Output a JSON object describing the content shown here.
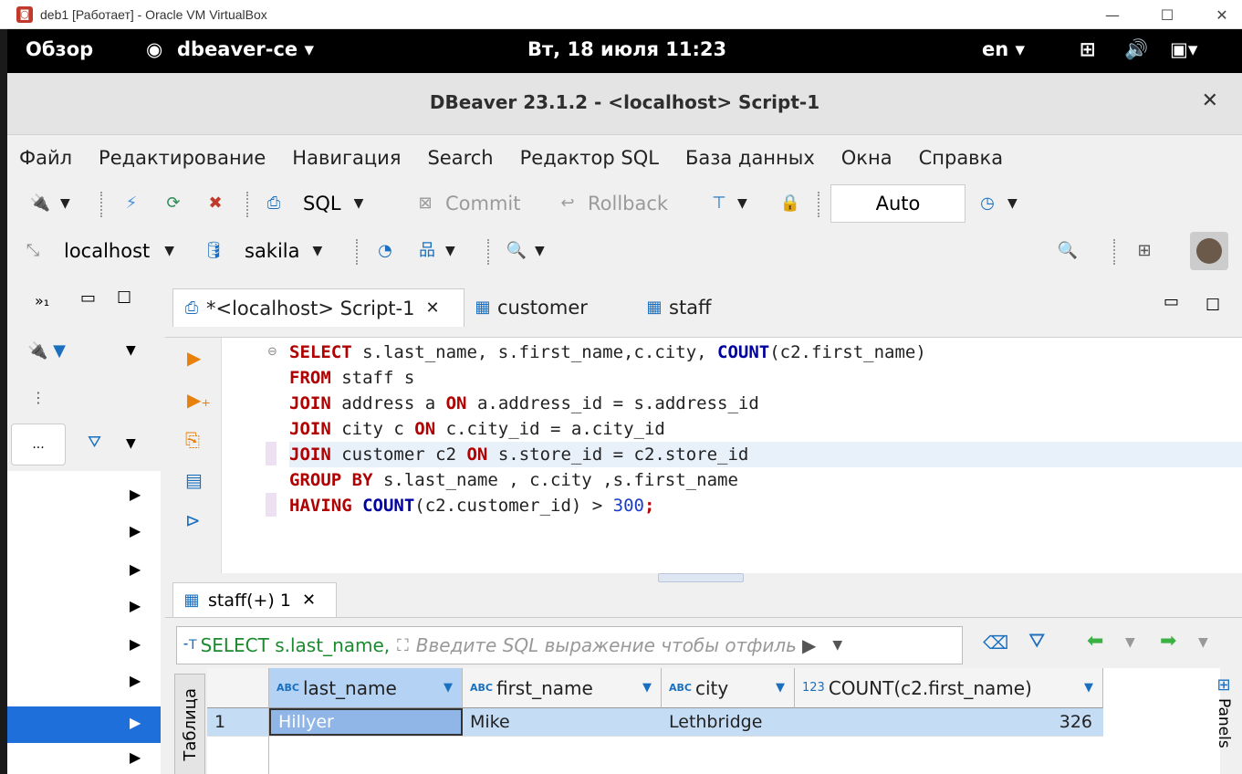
{
  "vbox": {
    "title": "deb1 [Работает] - Oracle VM VirtualBox"
  },
  "gnome": {
    "overview": "Обзор",
    "app": "dbeaver-ce",
    "datetime": "Вт, 18 июля  11:23",
    "lang": "en"
  },
  "window": {
    "title": "DBeaver 23.1.2 - <localhost> Script-1"
  },
  "menu": [
    "Файл",
    "Редактирование",
    "Навигация",
    "Search",
    "Редактор SQL",
    "База данных",
    "Окна",
    "Справка"
  ],
  "toolbar1": {
    "sql": "SQL",
    "commit": "Commit",
    "rollback": "Rollback",
    "mode": "Auto"
  },
  "toolbar2": {
    "datasource": "localhost",
    "schema": "sakila"
  },
  "leftpane": {
    "search_placeholder": "..."
  },
  "tabs": [
    {
      "label": "*<localhost> Script-1"
    },
    {
      "label": "customer"
    },
    {
      "label": "staff"
    }
  ],
  "code_lines": [
    [
      {
        "t": "SELECT",
        "c": "kw"
      },
      {
        "t": " s.last_name, s.first_name,c.city, ",
        "c": ""
      },
      {
        "t": "COUNT",
        "c": "fn"
      },
      {
        "t": "(c2.first_name)",
        "c": ""
      }
    ],
    [
      {
        "t": "FROM",
        "c": "kw"
      },
      {
        "t": " staff s",
        "c": ""
      }
    ],
    [
      {
        "t": "JOIN",
        "c": "kw"
      },
      {
        "t": " address a ",
        "c": ""
      },
      {
        "t": "ON",
        "c": "kw"
      },
      {
        "t": " a.address_id = s.address_id",
        "c": ""
      }
    ],
    [
      {
        "t": "JOIN",
        "c": "kw"
      },
      {
        "t": " city c ",
        "c": ""
      },
      {
        "t": "ON",
        "c": "kw"
      },
      {
        "t": " c.city_id = a.city_id",
        "c": ""
      }
    ],
    [
      {
        "t": "JOIN",
        "c": "kw"
      },
      {
        "t": " customer c2 ",
        "c": ""
      },
      {
        "t": "ON",
        "c": "kw"
      },
      {
        "t": " s.store_id = c2.store_id",
        "c": ""
      }
    ],
    [
      {
        "t": "GROUP BY",
        "c": "kw"
      },
      {
        "t": " s.last_name , c.city ,s.first_name",
        "c": ""
      }
    ],
    [
      {
        "t": "HAVING",
        "c": "kw"
      },
      {
        "t": " ",
        "c": ""
      },
      {
        "t": "COUNT",
        "c": "fn"
      },
      {
        "t": "(c2.customer_id) > ",
        "c": ""
      },
      {
        "t": "300",
        "c": "num"
      },
      {
        "t": ";",
        "c": "kw"
      }
    ]
  ],
  "results": {
    "tab_label": "staff(+) 1",
    "query_preview": "SELECT s.last_name,",
    "filter_placeholder": "Введите SQL выражение чтобы отфиль",
    "side_label": "Таблица",
    "panels_label": "Panels",
    "columns": [
      "last_name",
      "first_name",
      "city",
      "COUNT(c2.first_name)"
    ],
    "col_types": [
      "ABC",
      "ABC",
      "ABC",
      "123"
    ],
    "rows": [
      {
        "num": "1",
        "cells": [
          "Hillyer",
          "Mike",
          "Lethbridge",
          "326"
        ]
      }
    ]
  }
}
